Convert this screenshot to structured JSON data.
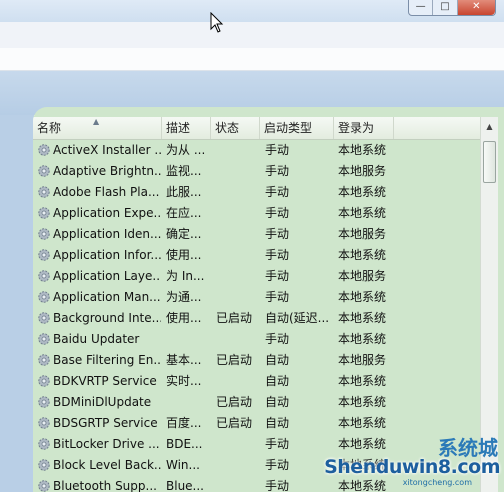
{
  "window": {
    "minimize_icon": "minimize-icon",
    "maximize_icon": "maximize-icon",
    "close_icon": "close-icon"
  },
  "columns": {
    "name": "名称",
    "description": "描述",
    "status": "状态",
    "startup_type": "启动类型",
    "logon_as": "登录为"
  },
  "services": [
    {
      "name": "ActiveX Installer ...",
      "description": "为从 ...",
      "status": "",
      "startup_type": "手动",
      "logon_as": "本地系统"
    },
    {
      "name": "Adaptive Brightn...",
      "description": "监视...",
      "status": "",
      "startup_type": "手动",
      "logon_as": "本地服务"
    },
    {
      "name": "Adobe Flash Pla...",
      "description": "此服...",
      "status": "",
      "startup_type": "手动",
      "logon_as": "本地系统"
    },
    {
      "name": "Application Expe...",
      "description": "在应...",
      "status": "",
      "startup_type": "手动",
      "logon_as": "本地系统"
    },
    {
      "name": "Application Iden...",
      "description": "确定...",
      "status": "",
      "startup_type": "手动",
      "logon_as": "本地服务"
    },
    {
      "name": "Application Infor...",
      "description": "使用...",
      "status": "",
      "startup_type": "手动",
      "logon_as": "本地系统"
    },
    {
      "name": "Application Laye...",
      "description": "为 In...",
      "status": "",
      "startup_type": "手动",
      "logon_as": "本地服务"
    },
    {
      "name": "Application Man...",
      "description": "为通...",
      "status": "",
      "startup_type": "手动",
      "logon_as": "本地系统"
    },
    {
      "name": "Background Inte...",
      "description": "使用...",
      "status": "已启动",
      "startup_type": "自动(延迟...",
      "logon_as": "本地系统"
    },
    {
      "name": "Baidu Updater",
      "description": "",
      "status": "",
      "startup_type": "手动",
      "logon_as": "本地系统"
    },
    {
      "name": "Base Filtering En...",
      "description": "基本...",
      "status": "已启动",
      "startup_type": "自动",
      "logon_as": "本地服务"
    },
    {
      "name": "BDKVRTP Service",
      "description": "实时...",
      "status": "",
      "startup_type": "自动",
      "logon_as": "本地系统"
    },
    {
      "name": "BDMiniDlUpdate",
      "description": "",
      "status": "已启动",
      "startup_type": "自动",
      "logon_as": "本地系统"
    },
    {
      "name": "BDSGRTP Service",
      "description": "百度...",
      "status": "已启动",
      "startup_type": "自动",
      "logon_as": "本地系统"
    },
    {
      "name": "BitLocker Drive ...",
      "description": "BDE...",
      "status": "",
      "startup_type": "手动",
      "logon_as": "本地系统"
    },
    {
      "name": "Block Level Back...",
      "description": "Win...",
      "status": "",
      "startup_type": "手动",
      "logon_as": "本地系统"
    },
    {
      "name": "Bluetooth Supp...",
      "description": "Blue...",
      "status": "",
      "startup_type": "手动",
      "logon_as": "本地系统"
    }
  ],
  "watermark": {
    "brand": "系统城",
    "site": "Shenduwin8.com",
    "sub": "xitongcheng.com"
  },
  "colors": {
    "panel_bg": "#cfe6cc",
    "header_bg": "#eef3ec",
    "banner": "#bdd3ea"
  }
}
